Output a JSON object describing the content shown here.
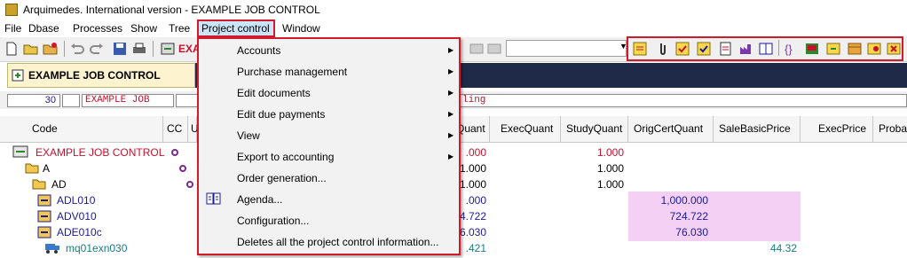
{
  "window": {
    "title": "Arquimedes. International version - EXAMPLE JOB CONTROL"
  },
  "menubar": {
    "items": [
      "File",
      "Dbase",
      "Processes",
      "Show",
      "Tree",
      "Project control",
      "Window"
    ]
  },
  "toolbar": {
    "partial_text": "EXA"
  },
  "document": {
    "title": "EXAMPLE JOB CONTROL",
    "info": {
      "number": "30",
      "code": "EXAMPLE JOB",
      "partial_right": "ling"
    }
  },
  "grid": {
    "columns": [
      "Code",
      "CC",
      "U",
      "Quant",
      "ExecQuant",
      "StudyQuant",
      "OrigCertQuant",
      "SaleBasicPrice",
      "ExecPrice",
      "Proba"
    ],
    "rows": [
      {
        "code": "EXAMPLE JOB CONTROL",
        "quant": ".000",
        "study": "1.000"
      },
      {
        "code": "A",
        "quant": "1.000",
        "study": "1.000"
      },
      {
        "code": "AD",
        "quant": "1.000",
        "study": "1.000"
      },
      {
        "code": "ADL010",
        "quant": ".000",
        "orig": "1,000.000"
      },
      {
        "code": "ADV010",
        "quant": "4.722",
        "orig": "724.722"
      },
      {
        "code": "ADE010c",
        "quant": "6.030",
        "orig": "76.030"
      },
      {
        "code": "mq01exn030",
        "quant": ".421",
        "sale": "44.32"
      }
    ]
  },
  "project_menu": {
    "items": [
      {
        "label": "Accounts",
        "submenu": true
      },
      {
        "label": "Purchase management",
        "submenu": true
      },
      {
        "label": "Edit documents",
        "submenu": true
      },
      {
        "label": "Edit due payments",
        "submenu": true
      },
      {
        "label": "View",
        "submenu": true
      },
      {
        "label": "Export to accounting",
        "submenu": true
      },
      {
        "label": "Order generation...",
        "submenu": false
      },
      {
        "label": "Agenda...",
        "submenu": false,
        "icon": "agenda-icon"
      },
      {
        "label": "Configuration...",
        "submenu": false
      },
      {
        "label": "Deletes all the project control information...",
        "submenu": false
      }
    ]
  },
  "colors": {
    "highlight": "#d11a2a",
    "pink": "#f4d1f4",
    "dark": "#1e2a47"
  }
}
